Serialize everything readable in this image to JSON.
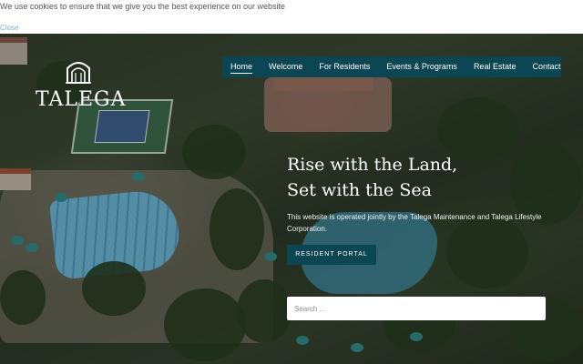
{
  "cookie": {
    "message": "We use cookies to ensure that we give you the best experience on our website",
    "close_label": "Close"
  },
  "brand": {
    "name": "TALEGA",
    "logo_icon": "arched-gate-icon"
  },
  "nav": {
    "items": [
      {
        "label": "Home",
        "active": true
      },
      {
        "label": "Welcome"
      },
      {
        "label": "For Residents"
      },
      {
        "label": "Events & Programs"
      },
      {
        "label": "Real Estate"
      },
      {
        "label": "Contact"
      }
    ]
  },
  "hero": {
    "headline_line1": "Rise with the Land,",
    "headline_line2": "Set with the Sea",
    "description": "This website is operated jointly by the Talega Maintenance and Talega Lifestyle Corporation.",
    "portal_button": "RESIDENT PORTAL",
    "search_placeholder": "Search ..."
  },
  "colors": {
    "nav_bg": "#0c4653",
    "button_bg": "#0c4653",
    "close_link": "#7fb3c8",
    "text_light": "#ffffff"
  }
}
